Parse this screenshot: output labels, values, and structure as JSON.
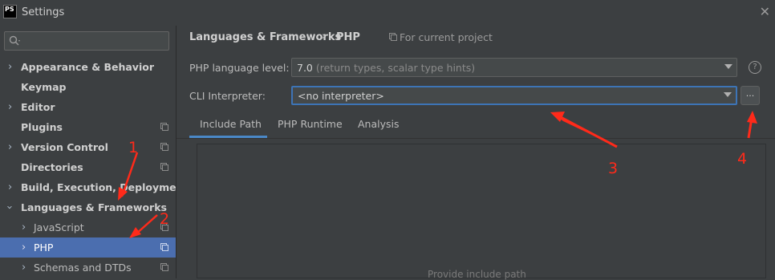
{
  "window": {
    "app_badge": "PS",
    "title": "Settings",
    "close_glyph": "✕"
  },
  "sidebar": {
    "search": {
      "value": "",
      "placeholder": ""
    },
    "items": [
      {
        "label": "Appearance & Behavior",
        "expandable": true,
        "level": 0
      },
      {
        "label": "Keymap",
        "expandable": false,
        "level": 0
      },
      {
        "label": "Editor",
        "expandable": true,
        "level": 0
      },
      {
        "label": "Plugins",
        "expandable": false,
        "level": 0,
        "project_icon": true
      },
      {
        "label": "Version Control",
        "expandable": true,
        "level": 0,
        "project_icon": true
      },
      {
        "label": "Directories",
        "expandable": false,
        "level": 0,
        "project_icon": true
      },
      {
        "label": "Build, Execution, Deployment",
        "expandable": true,
        "level": 0
      },
      {
        "label": "Languages & Frameworks",
        "expandable": true,
        "expanded": true,
        "level": 0
      },
      {
        "label": "JavaScript",
        "expandable": true,
        "level": 1,
        "project_icon": true
      },
      {
        "label": "PHP",
        "expandable": true,
        "level": 1,
        "selected": true,
        "project_icon": true
      },
      {
        "label": "Schemas and DTDs",
        "expandable": true,
        "level": 1,
        "project_icon": true
      }
    ]
  },
  "breadcrumb": {
    "parent": "Languages & Frameworks",
    "separator": "›",
    "current": "PHP",
    "scope": "For current project"
  },
  "form": {
    "language_level": {
      "label": "PHP language level:",
      "value": "7.0",
      "hint": "(return types, scalar type hints)"
    },
    "cli_interpreter": {
      "label": "CLI Interpreter:",
      "value": "<no interpreter>",
      "browse_label": "..."
    }
  },
  "tabs": [
    {
      "label": "Include Path",
      "active": true
    },
    {
      "label": "PHP Runtime",
      "active": false
    },
    {
      "label": "Analysis",
      "active": false
    }
  ],
  "include_path_panel": {
    "empty_text": "Provide include path"
  },
  "annotations": [
    "1",
    "2",
    "3",
    "4"
  ],
  "colors": {
    "selection": "#4b6eaf",
    "annotation": "#ff2a1a",
    "focus": "#3d74b6"
  }
}
